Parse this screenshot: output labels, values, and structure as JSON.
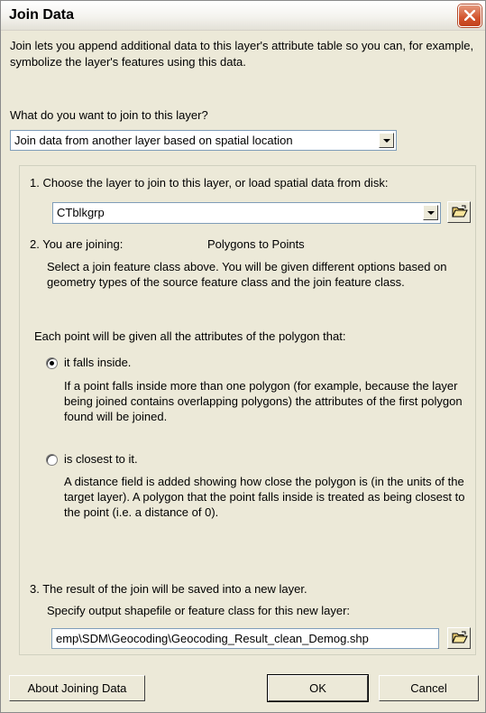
{
  "window": {
    "title": "Join Data",
    "close_icon": "close-icon"
  },
  "intro": {
    "text": "Join lets you append additional data to this layer's attribute table so you can, for example, symbolize the layer's features using this data.",
    "question": "What do you want to join to this layer?"
  },
  "join_type": {
    "selected": "Join data from another layer based on spatial location"
  },
  "step1": {
    "label": "1.  Choose the layer to join to this layer, or load spatial data from disk:",
    "layer_value": "CTblkgrp",
    "open_icon": "folder-open-icon"
  },
  "step2": {
    "label_prefix": "2.  You are joining:",
    "joining_value": "Polygons to Points",
    "note": "Select a join feature class above.  You will be given different options based on geometry types of the source feature class and the join feature class.",
    "intro": "Each point will be given all the attributes of the polygon that:",
    "option_inside": {
      "label": "it falls inside.",
      "checked": true,
      "description": "If a point falls inside more than one polygon (for example, because the layer being joined contains overlapping polygons) the attributes of the first polygon found will be joined."
    },
    "option_closest": {
      "label": "is closest to it.",
      "checked": false,
      "description": "A distance field is added showing how close the polygon is (in the units of the target layer). A polygon that the point falls inside is treated as being closest to the point (i.e. a distance of 0)."
    }
  },
  "step3": {
    "label": "3.  The result of the join will be saved into a new layer.",
    "specify": "Specify output shapefile or feature class for this new layer:",
    "output_value": "emp\\SDM\\Geocoding\\Geocoding_Result_clean_Demog.shp",
    "browse_icon": "folder-open-icon"
  },
  "footer": {
    "about_label": "About Joining Data",
    "ok_label": "OK",
    "cancel_label": "Cancel"
  }
}
